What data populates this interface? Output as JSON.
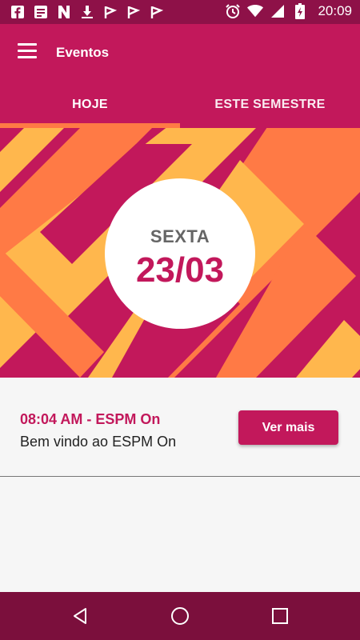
{
  "status_bar": {
    "time": "20:09",
    "left_icons": [
      "facebook-icon",
      "message-icon",
      "n-icon",
      "download-icon",
      "flag-icon",
      "flag-icon",
      "flag-icon"
    ],
    "right_icons": [
      "alarm-icon",
      "wifi-icon",
      "signal-icon",
      "battery-charging-icon"
    ]
  },
  "app_bar": {
    "title": "Eventos"
  },
  "tabs": [
    {
      "label": "HOJE",
      "active": true
    },
    {
      "label": "ESTE SEMESTRE",
      "active": false
    }
  ],
  "hero": {
    "weekday": "SEXTA",
    "date": "23/03"
  },
  "events": [
    {
      "time": "08:04 AM - ESPM On",
      "title": "Bem vindo ao ESPM On",
      "button_label": "Ver mais"
    }
  ],
  "colors": {
    "primary": "#c2185b",
    "primary_dark": "#8e1148",
    "nav_bar": "#7b0f3c",
    "accent_orange": "#ff7a45",
    "accent_yellow": "#ffb74d"
  },
  "nav_bar": {
    "buttons": [
      "back-icon",
      "home-icon",
      "recents-icon"
    ]
  }
}
